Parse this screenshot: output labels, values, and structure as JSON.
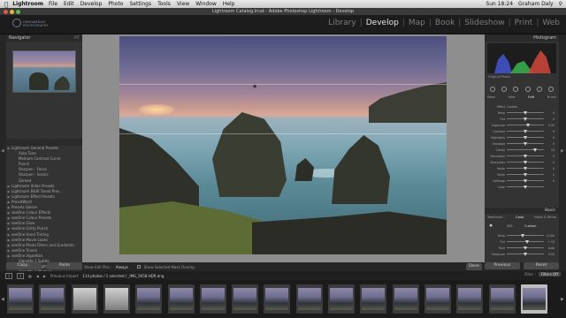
{
  "menubar": {
    "apple": "",
    "app": "Lightroom",
    "items": [
      "File",
      "Edit",
      "Develop",
      "Photo",
      "Settings",
      "Tools",
      "View",
      "Window",
      "Help"
    ],
    "clock": "Sun 18:24",
    "user": "Graham Daly"
  },
  "window": {
    "title": "Lightroom Catalog.lrcat - Adobe Photoshop Lightroom - Develop"
  },
  "identity": {
    "line1": "GRAHAMDALY",
    "line2": "PHOTOGRAPHY"
  },
  "modules": [
    "Library",
    "Develop",
    "Map",
    "Book",
    "Slideshow",
    "Print",
    "Web"
  ],
  "active_module": "Develop",
  "navigator": {
    "title": "Navigator",
    "zoom": "FIT"
  },
  "presets": [
    {
      "label": "Lightroom General Presets",
      "level": 0
    },
    {
      "label": "Auto Tone",
      "level": 1
    },
    {
      "label": "Medium Contrast Curve",
      "level": 1
    },
    {
      "label": "Punch",
      "level": 1
    },
    {
      "label": "Sharpen - Faces",
      "level": 1
    },
    {
      "label": "Sharpen - Scenic",
      "level": 1
    },
    {
      "label": "Zeroed",
      "level": 1
    },
    {
      "label": "Lightroom Video Presets",
      "level": 0
    },
    {
      "label": "Lightroom B&W Toned Pres...",
      "level": 0
    },
    {
      "label": "Lightroom Effect Presets",
      "level": 0
    },
    {
      "label": "PresetWord",
      "level": 0
    },
    {
      "label": "Presets Galore",
      "level": 0
    },
    {
      "label": "seeOne Colour Effects",
      "level": 0
    },
    {
      "label": "seeOne Colour Presets",
      "level": 0
    },
    {
      "label": "seeOne Glow",
      "level": 0
    },
    {
      "label": "seeOne Gritty Punch",
      "level": 0
    },
    {
      "label": "seeOne Hand Tinting",
      "level": 0
    },
    {
      "label": "seeOne Movie Looks",
      "level": 0
    },
    {
      "label": "seeOne Photo Filters and Gradients",
      "level": 0
    },
    {
      "label": "seeOne Toners",
      "level": 0
    },
    {
      "label": "seeOne Vignettes",
      "level": 0
    },
    {
      "label": "Vignette 1 Subtle",
      "level": 1
    },
    {
      "label": "Vignette 2 Light",
      "level": 1
    },
    {
      "label": "Vignette 3 Medium",
      "level": 1
    },
    {
      "label": "Vignette 4 Heavy",
      "level": 1
    }
  ],
  "left_buttons": {
    "copy": "Copy...",
    "paste": "Paste"
  },
  "toolbar": {
    "label": "Show Edit Pins :",
    "value": "Always",
    "overlay": "Show Selected Mask Overlay",
    "done": "Done"
  },
  "right_panel": {
    "histogram": "Histogram",
    "original": "Original Photo",
    "tabs": [
      "Mask",
      "New",
      "Edit",
      "Brush"
    ],
    "active_tab": "Edit",
    "effect_label": "Effect",
    "effect_value": "Custom",
    "sliders": [
      {
        "label": "Temp",
        "value": "0",
        "pos": 0.5
      },
      {
        "label": "Tint",
        "value": "0",
        "pos": 0.5
      },
      {
        "label": "Exposure",
        "value": "0.30",
        "pos": 0.58
      },
      {
        "label": "Contrast",
        "value": "0",
        "pos": 0.5
      },
      {
        "label": "Highlights",
        "value": "0",
        "pos": 0.5
      },
      {
        "label": "Shadows",
        "value": "0",
        "pos": 0.5
      },
      {
        "label": "Clarity",
        "value": "53",
        "pos": 0.76
      },
      {
        "label": "Saturation",
        "value": "0",
        "pos": 0.5
      },
      {
        "label": "Sharpness",
        "value": "0",
        "pos": 0.5
      },
      {
        "label": "Noise",
        "value": "0",
        "pos": 0.5
      },
      {
        "label": "Moire",
        "value": "0",
        "pos": 0.5
      },
      {
        "label": "Defringe",
        "value": "0",
        "pos": 0.5
      },
      {
        "label": "Color",
        "value": "",
        "pos": 0.5
      }
    ],
    "basic": "Basic",
    "treatment_label": "Treatment :",
    "treatment": [
      "Color",
      "Black & White"
    ],
    "wb_label": "WB :",
    "wb_value": "Custom",
    "sliders2": [
      {
        "label": "Temp",
        "value": "4,200",
        "pos": 0.42
      },
      {
        "label": "Tint",
        "value": "+ 10",
        "pos": 0.55
      },
      {
        "label": "Tone",
        "value": "Auto",
        "pos": 0.5
      },
      {
        "label": "Exposure",
        "value": "0.00",
        "pos": 0.5
      }
    ]
  },
  "right_buttons": {
    "previous": "Previous",
    "reset": "Reset"
  },
  "filmstrip_bar": {
    "n1": "1",
    "n2": "2",
    "previous_import": "Previous Import",
    "count": "114 photos / 1 selected / _IMG_5658-HDR.dng",
    "filter_label": "Filter :",
    "filter_value": "Filters Off"
  },
  "filmstrip": {
    "frame_count": 17,
    "selected_index": 16
  }
}
